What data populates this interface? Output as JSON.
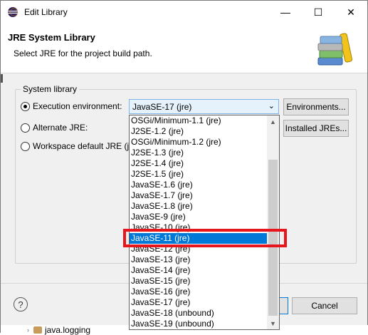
{
  "window": {
    "title": "Edit Library",
    "minimize_glyph": "—",
    "maximize_glyph": "☐",
    "close_glyph": "✕"
  },
  "header": {
    "title": "JRE System Library",
    "subtitle": "Select JRE for the project build path."
  },
  "group": {
    "label": "System library",
    "options": {
      "execution": "Execution environment:",
      "alternate": "Alternate JRE:",
      "workspace": "Workspace default JRE (jre)"
    },
    "selected_option": "execution"
  },
  "combo": {
    "value": "JavaSE-17 (jre)",
    "arrow": "⌄"
  },
  "buttons": {
    "environments": "Environments...",
    "installed": "Installed JREs...",
    "cancel": "Cancel",
    "help": "?"
  },
  "dropdown": {
    "items": [
      "OSGi/Minimum-1.1 (jre)",
      "J2SE-1.2 (jre)",
      "OSGi/Minimum-1.2 (jre)",
      "J2SE-1.3 (jre)",
      "J2SE-1.4 (jre)",
      "J2SE-1.5 (jre)",
      "JavaSE-1.6 (jre)",
      "JavaSE-1.7 (jre)",
      "JavaSE-1.8 (jre)",
      "JavaSE-9 (jre)",
      "JavaSE-10 (jre)",
      "JavaSE-11 (jre)",
      "JavaSE-12 (jre)",
      "JavaSE-13 (jre)",
      "JavaSE-14 (jre)",
      "JavaSE-15 (jre)",
      "JavaSE-16 (jre)",
      "JavaSE-17 (jre)",
      "JavaSE-18 (unbound)",
      "JavaSE-19 (unbound)"
    ],
    "selected_index": 11,
    "scroll_up": "▲",
    "scroll_down": "▼"
  },
  "background": {
    "item": "java.logging"
  },
  "colors": {
    "selection": "#0078d7",
    "highlight": "#e8161c"
  }
}
